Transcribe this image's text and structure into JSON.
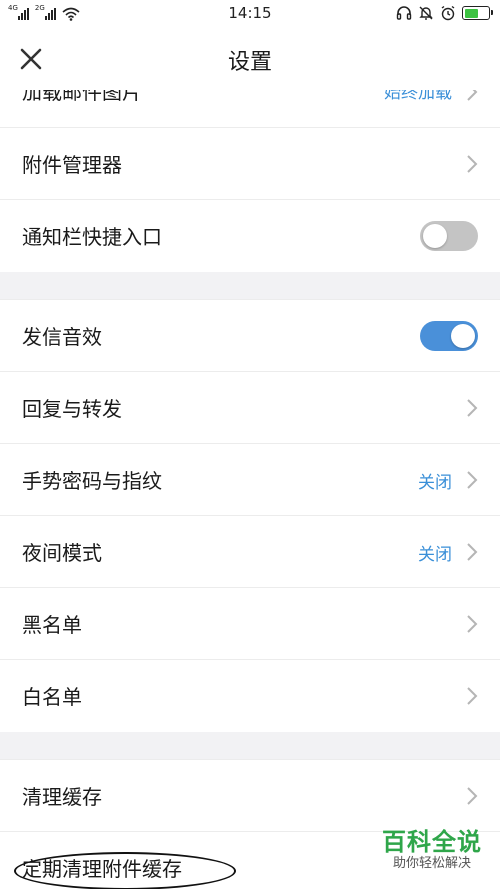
{
  "status_bar": {
    "time": "14:15",
    "sim1_tag": "4G",
    "sim2_tag": "2G",
    "battery_level": 0.6,
    "icons": [
      "signal-icon",
      "wifi-icon",
      "headset-icon",
      "mute-bell-icon",
      "alarm-icon",
      "battery-icon"
    ]
  },
  "header": {
    "title": "设置",
    "close_icon": "close-icon"
  },
  "sections": [
    {
      "items": [
        {
          "label": "加载邮件图片",
          "value": "始终加载",
          "type": "chevron",
          "partial": true
        },
        {
          "label": "附件管理器",
          "type": "chevron"
        },
        {
          "label": "通知栏快捷入口",
          "type": "switch",
          "on": false
        }
      ]
    },
    {
      "items": [
        {
          "label": "发信音效",
          "type": "switch",
          "on": true
        },
        {
          "label": "回复与转发",
          "type": "chevron"
        },
        {
          "label": "手势密码与指纹",
          "value": "关闭",
          "type": "chevron"
        },
        {
          "label": "夜间模式",
          "value": "关闭",
          "type": "chevron"
        },
        {
          "label": "黑名单",
          "type": "chevron"
        },
        {
          "label": "白名单",
          "type": "chevron"
        }
      ]
    },
    {
      "items": [
        {
          "label": "清理缓存",
          "type": "chevron"
        },
        {
          "label": "定期清理附件缓存",
          "type": "none"
        }
      ]
    }
  ],
  "watermark": {
    "title": "百科全说",
    "subtitle": "助你轻松解决"
  },
  "colors": {
    "accent": "#4a90d9",
    "value_text": "#3a8fd8",
    "switch_off": "#c4c4c4",
    "section_gap": "#f2f2f4",
    "watermark": "#2fa64a"
  }
}
